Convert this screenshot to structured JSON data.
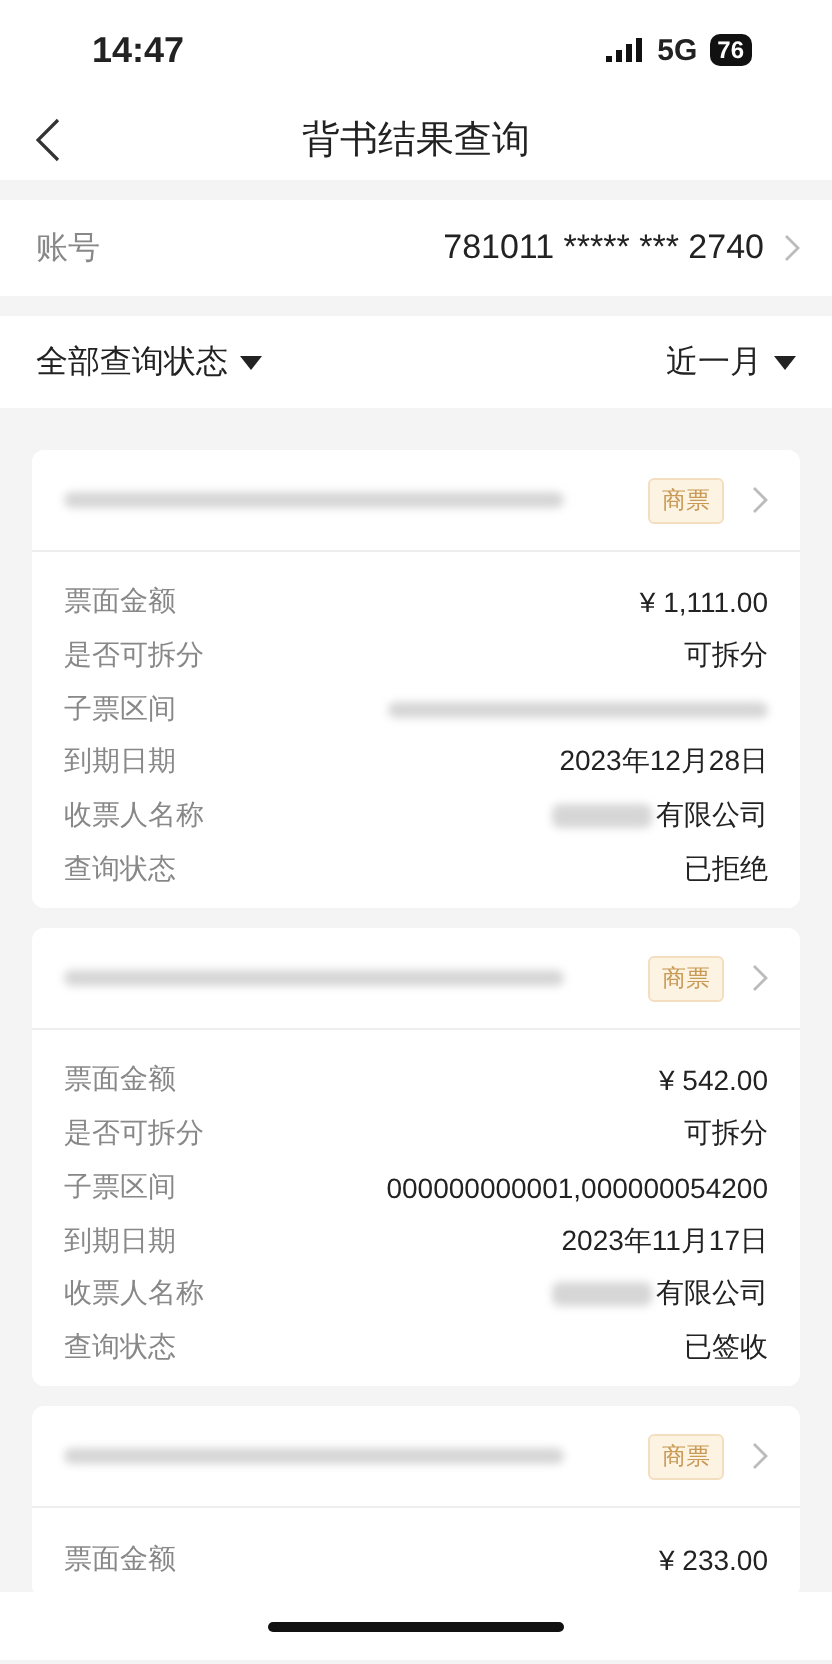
{
  "status_bar": {
    "time": "14:47",
    "network": "5G",
    "battery": "76"
  },
  "nav": {
    "title": "背书结果查询"
  },
  "account": {
    "label": "账号",
    "value": "781011 ***** *** 2740"
  },
  "filters": [
    {
      "label": "全部查询状态"
    },
    {
      "label": "近一月"
    }
  ],
  "cards": [
    {
      "number_redacted": true,
      "tag": "商票",
      "fields": [
        {
          "label": "票面金额",
          "value": "¥ 1,111.00"
        },
        {
          "label": "是否可拆分",
          "value": "可拆分"
        },
        {
          "label": "子票区间",
          "value_redacted": true
        },
        {
          "label": "到期日期",
          "value": "2023年12月28日"
        },
        {
          "label": "收票人名称",
          "value": "有限公司",
          "prefix_redacted": true
        },
        {
          "label": "查询状态",
          "value": "已拒绝"
        }
      ]
    },
    {
      "number_redacted": true,
      "tag": "商票",
      "fields": [
        {
          "label": "票面金额",
          "value": "¥ 542.00"
        },
        {
          "label": "是否可拆分",
          "value": "可拆分"
        },
        {
          "label": "子票区间",
          "value": "000000000001,000000054200"
        },
        {
          "label": "到期日期",
          "value": "2023年11月17日"
        },
        {
          "label": "收票人名称",
          "value": "有限公司",
          "prefix_redacted": true
        },
        {
          "label": "查询状态",
          "value": "已签收"
        }
      ]
    },
    {
      "number_redacted": true,
      "tag": "商票",
      "fields": [
        {
          "label": "票面金额",
          "value": "¥ 233.00"
        }
      ]
    }
  ]
}
